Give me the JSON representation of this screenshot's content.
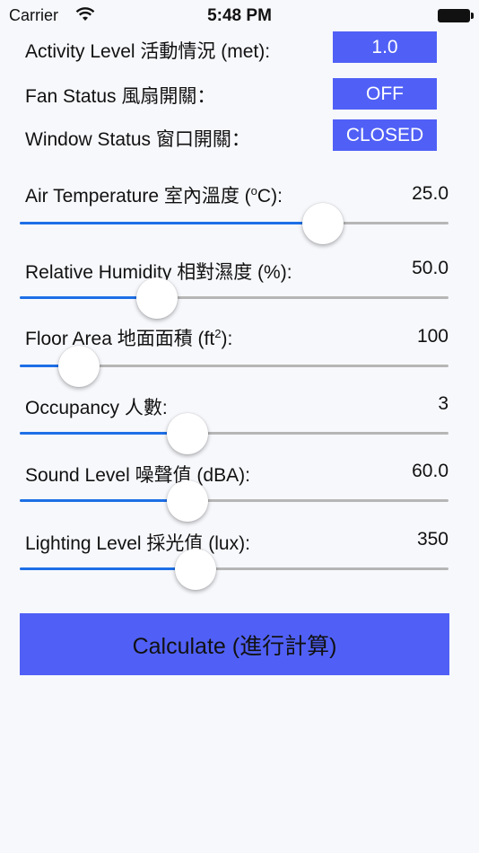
{
  "status_bar": {
    "carrier": "Carrier",
    "time": "5:48 PM"
  },
  "settings": [
    {
      "label": "Activity Level 活動情況 (met):",
      "value": "1.0"
    },
    {
      "label": "Fan Status 風扇開關：",
      "value": "OFF"
    },
    {
      "label": "Window Status 窗口開關：",
      "value": "CLOSED"
    }
  ],
  "sliders": [
    {
      "label_pre": "Air Temperature 室內溫度 (",
      "label_sup": "o",
      "label_post": "C):",
      "value": "25.0",
      "fraction": 0.73
    },
    {
      "label_pre": "Relative Humidity 相對濕度 (%):",
      "label_sup": "",
      "label_post": "",
      "value": "50.0",
      "fraction": 0.3
    },
    {
      "label_pre": "Floor Area 地面面積 (ft",
      "label_sup": "2",
      "label_post": "):",
      "value": "100",
      "fraction": 0.1
    },
    {
      "label_pre": "Occupancy 人數:",
      "label_sup": "",
      "label_post": "",
      "value": "3",
      "fraction": 0.38
    },
    {
      "label_pre": "Sound Level 噪聲值 (dBA):",
      "label_sup": "",
      "label_post": "",
      "value": "60.0",
      "fraction": 0.38
    },
    {
      "label_pre": "Lighting Level 採光值 (lux):",
      "label_sup": "",
      "label_post": "",
      "value": "350",
      "fraction": 0.4
    }
  ],
  "calculate_label": "Calculate (進行計算)",
  "colors": {
    "accent_button": "#5060f6",
    "slider_fill": "#1d6fe6",
    "track": "#b6b6b6"
  }
}
